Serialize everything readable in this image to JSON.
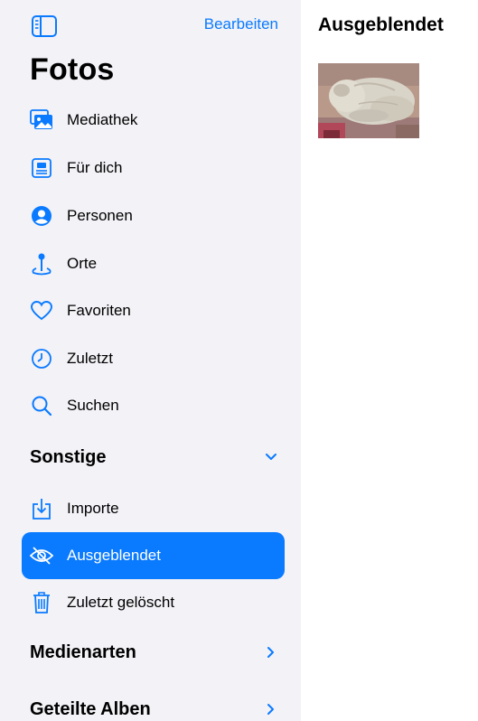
{
  "header": {
    "edit_label": "Bearbeiten",
    "title": "Fotos"
  },
  "library": {
    "items": [
      {
        "label": "Mediathek",
        "icon": "photo-library-icon"
      },
      {
        "label": "Für dich",
        "icon": "for-you-icon"
      },
      {
        "label": "Personen",
        "icon": "person-circle-icon"
      },
      {
        "label": "Orte",
        "icon": "map-pin-icon"
      },
      {
        "label": "Favoriten",
        "icon": "heart-icon"
      },
      {
        "label": "Zuletzt",
        "icon": "clock-icon"
      },
      {
        "label": "Suchen",
        "icon": "search-icon"
      }
    ]
  },
  "sections": {
    "other": {
      "label": "Sonstige",
      "expanded": true,
      "items": [
        {
          "label": "Importe",
          "icon": "import-icon"
        },
        {
          "label": "Ausgeblendet",
          "icon": "eye-slash-icon",
          "selected": true
        },
        {
          "label": "Zuletzt gelöscht",
          "icon": "trash-icon"
        }
      ]
    },
    "media_types": {
      "label": "Medienarten",
      "expanded": false
    },
    "shared_albums": {
      "label": "Geteilte Alben",
      "expanded": false
    }
  },
  "main": {
    "title": "Ausgeblendet"
  },
  "colors": {
    "accent": "#0a7aff",
    "sidebar_bg": "#f2f2f7"
  }
}
